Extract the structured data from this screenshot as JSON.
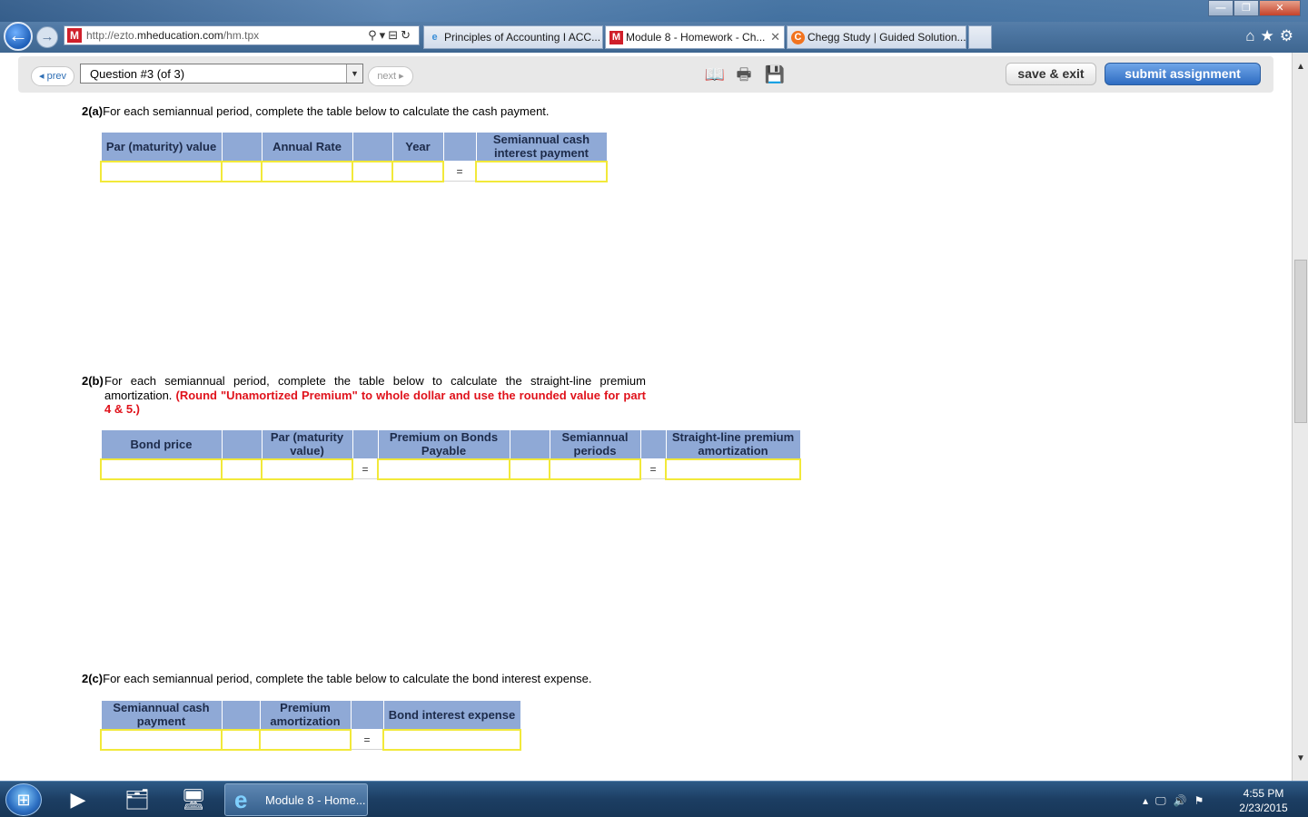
{
  "browser": {
    "url_prefix": "http://ezto.",
    "url_domain": "mheducation.com",
    "url_path": "/hm.tpx",
    "tabs": [
      {
        "label": "Principles of Accounting I ACC..."
      },
      {
        "label": "Module 8 - Homework - Ch..."
      },
      {
        "label": "Chegg Study | Guided Solution..."
      }
    ]
  },
  "toolbar": {
    "prev_label": "◂ prev",
    "question_select": "Question #3 (of 3)",
    "next_label": "next ▸",
    "save_label": "save & exit",
    "submit_label": "submit assignment"
  },
  "part_a": {
    "num": "2(a)",
    "prompt": "For each semiannual period, complete the table below to calculate the cash payment.",
    "headers": [
      "Par (maturity) value",
      "",
      "Annual Rate",
      "",
      "Year",
      "",
      "Semiannual cash interest payment"
    ],
    "eq": "="
  },
  "part_b": {
    "num": "2(b)",
    "prompt": "For each semiannual period, complete the table below to calculate the straight-line premium amortization. ",
    "instruction": "(Round \"Unamortized Premium\" to whole dollar and use the rounded value for part 4 & 5.)",
    "headers": [
      "Bond price",
      "",
      "Par (maturity value)",
      "",
      "Premium on Bonds Payable",
      "",
      "Semiannual periods",
      "",
      "Straight-line premium amortization"
    ],
    "eq": "="
  },
  "part_c": {
    "num": "2(c)",
    "prompt": "For each semiannual period, complete the table below to calculate the bond interest expense.",
    "headers": [
      "Semiannual cash payment",
      "",
      "Premium amortization",
      "",
      "Bond interest expense"
    ],
    "eq": "="
  },
  "taskbar": {
    "active_window": "Module 8 - Home...",
    "time": "4:55 PM",
    "date": "2/23/2015"
  },
  "icons": [
    "back-arrow-icon",
    "forward-arrow-icon",
    "search-icon",
    "refresh-icon",
    "home-icon",
    "star-icon",
    "gear-icon",
    "book-icon",
    "printer-icon",
    "save-disk-icon",
    "windows-start-icon",
    "ie-icon"
  ],
  "colors": {
    "table_header": "#8fa9d6",
    "input_border": "#f2e93a",
    "instruction_red": "#e0121b",
    "submit_blue": "#2e6cc2"
  }
}
